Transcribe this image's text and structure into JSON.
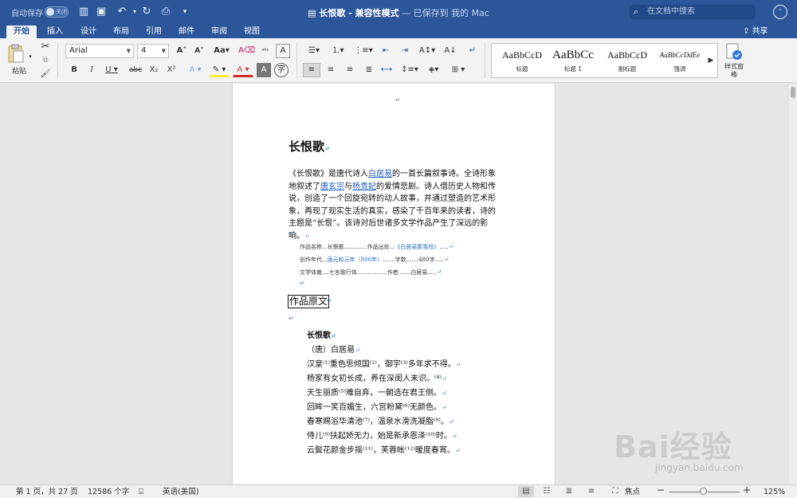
{
  "titlebar": {
    "autosave_label": "自动保存",
    "autosave_state": "关闭",
    "doc_title": "长恨歌 - 兼容性模式",
    "doc_saved": " — 已保存到 我的 Mac",
    "search_placeholder": "在文档中搜索"
  },
  "tabs": [
    "开始",
    "插入",
    "设计",
    "布局",
    "引用",
    "邮件",
    "审阅",
    "视图"
  ],
  "share_label": "共享",
  "ribbon": {
    "paste_label": "粘贴",
    "font_name": "Arial",
    "font_size": "4",
    "styles": [
      {
        "preview": "AaBbCcD",
        "name": "标题"
      },
      {
        "preview": "AaBbCc",
        "name": "标题 1"
      },
      {
        "preview": "AaBbCcD",
        "name": "副标题"
      },
      {
        "preview": "AaBbCcDdEe",
        "name": "强调"
      }
    ],
    "styles_pane_label": "样式窗格"
  },
  "document": {
    "heading": "长恨歌",
    "intro_parts": {
      "p1": "《长恨歌》是唐代诗人",
      "link1": "白居易",
      "p2": "的一首长篇叙事诗。全诗形象地叙述了",
      "link2": "唐玄宗",
      "p3": "与",
      "link3": "杨贵妃",
      "p4": "的爱情悲剧。诗人借历史人物和传说，创造了一个回旋宛转的动人故事，并通过塑造的艺术形象，再现了现实生活的真实，感染了千百年来的读者，诗的主题是“长恨”。该诗对后世诸多文学作品产生了深远的影响。"
    },
    "info_rows": [
      {
        "k1": "作品名称",
        "v1": "长恨歌",
        "k2": "作品出处",
        "v2": "《白居易集笺校》"
      },
      {
        "k1": "创作年代",
        "v1": "唐元和元年（806年）",
        "k2": "字数",
        "v2": "480字"
      },
      {
        "k1": "文学体裁",
        "v1": "七言歌行体",
        "k2": "作者",
        "v2": "白居易"
      }
    ],
    "section_title": "作品原文",
    "poem_title": "长恨歌",
    "poem_author": "（唐）白居易",
    "poem_lines": [
      "汉皇⁽¹⁾重色思倾国⁽²⁾，御宇⁽³⁾多年求不得。",
      "杨家有女初长成，养在深闺人未识。⁽⁴⁾",
      "天生丽质⁽⁵⁾难自弃，一朝选在君王侧。",
      "回眸一笑百媚生，六宫粉黛⁽⁶⁾无颜色。",
      "春寒赐浴华清池⁽⁷⁾，温泉水滑洗凝脂⁽⁸⁾。",
      "侍儿⁽⁹⁾扶起娇无力，始是新承恩泽⁽¹⁰⁾时。",
      "云鬓花颜金步摇⁽¹¹⁾，芙蓉帐⁽¹²⁾暖度春宵。"
    ]
  },
  "statusbar": {
    "page_info": "第 1 页，共 27 页",
    "word_count": "12586 个字",
    "language": "英语(美国)",
    "focus_label": "焦点",
    "zoom": "125%"
  },
  "watermark": {
    "big": "Bai经验",
    "small": "jingyan.baidu.com"
  },
  "colors": {
    "accent": "#2b579a",
    "link": "#1f5fbf"
  }
}
